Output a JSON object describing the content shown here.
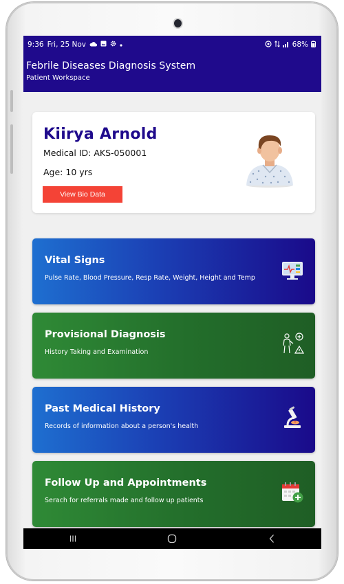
{
  "status_bar": {
    "time": "9:36",
    "date": "Fri, 25 Nov",
    "battery": "68%"
  },
  "app_bar": {
    "title": "Febrile Diseases Diagnosis System",
    "subtitle": "Patient Workspace"
  },
  "patient": {
    "name": "Kiirya  Arnold",
    "medical_id": "Medical ID: AKS-050001",
    "age": "Age: 10 yrs",
    "view_bio_label": "View Bio Data"
  },
  "cards": [
    {
      "title": "Vital Signs",
      "subtitle": "Pulse Rate, Blood Pressure, Resp Rate, Weight, Height and Temp",
      "icon": "monitor-vitals-icon",
      "theme": "blue"
    },
    {
      "title": "Provisional Diagnosis",
      "subtitle": "History Taking and Examination",
      "icon": "patient-diagnosis-icon",
      "theme": "green"
    },
    {
      "title": "Past Medical History",
      "subtitle": "Records of information about a person's health",
      "icon": "microscope-icon",
      "theme": "blue"
    },
    {
      "title": "Follow Up and  Appointments",
      "subtitle": "Serach for referrals made and follow up patients",
      "icon": "calendar-add-icon",
      "theme": "green"
    }
  ],
  "colors": {
    "app_bar": "#1f0a8c",
    "accent_red": "#f44336",
    "card_blue": "#1b3fb4",
    "card_green": "#236e2b"
  },
  "nav_bar": [
    "recent-apps-icon",
    "home-icon",
    "back-icon"
  ]
}
